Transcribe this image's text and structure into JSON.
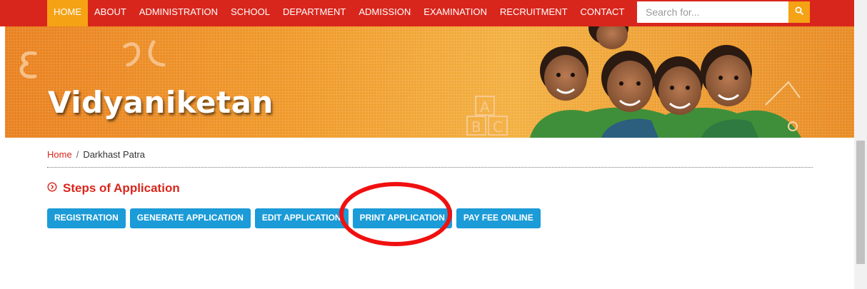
{
  "nav": {
    "items": [
      {
        "label": "HOME",
        "active": true
      },
      {
        "label": "ABOUT"
      },
      {
        "label": "ADMINISTRATION"
      },
      {
        "label": "SCHOOL"
      },
      {
        "label": "DEPARTMENT"
      },
      {
        "label": "ADMISSION"
      },
      {
        "label": "EXAMINATION"
      },
      {
        "label": "RECRUITMENT"
      },
      {
        "label": "CONTACT"
      }
    ]
  },
  "search": {
    "placeholder": "Search for...",
    "icon": "search-icon"
  },
  "banner": {
    "title": "Vidyaniketan"
  },
  "breadcrumb": {
    "home": "Home",
    "separator": "/",
    "current": "Darkhast Patra"
  },
  "steps": {
    "title": "Steps of Application",
    "icon": "circle-chevron-right-icon",
    "buttons": [
      {
        "label": "REGISTRATION"
      },
      {
        "label": "GENERATE APPLICATION"
      },
      {
        "label": "EDIT APPLICATION"
      },
      {
        "label": "PRINT APPLICATION"
      },
      {
        "label": "PAY FEE ONLINE"
      }
    ]
  },
  "colors": {
    "nav_bg": "#d9261c",
    "accent": "#f5a214",
    "button": "#1b9bd7",
    "highlight_circle": "#f01010"
  }
}
